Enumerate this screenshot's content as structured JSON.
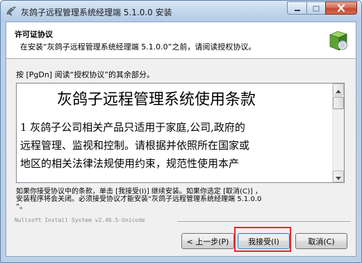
{
  "window": {
    "title": "灰鸽子远程管理系统经理端 5.1.0.0 安装"
  },
  "header": {
    "title": "许可证协议",
    "subtitle": "在安装“灰鸽子远程管理系统经理端 5.1.0.0”之前，请阅读授权协议。"
  },
  "instruction": "按 [PgDn] 阅读“授权协议”的其余部分。",
  "license": {
    "heading": "灰鸽子远程管理系统使用条款",
    "lines": [
      "1  灰鸽子公司相关产品只适用于家庭,公司,政府的",
      "远程管理、监视和控制。请根据并依照所在国家或",
      "地区的相关法律法规使用约束，规范性使用本产"
    ]
  },
  "notice": {
    "lines": [
      "如果你接受协议中的条款，单击 [我接受(I)] 继续安装。如果你选定 [取消(C)] ，",
      "安装程序将会关闭。必须接受协议才能安装“灰鸽子远程管理系统经理端 5.1.0.0",
      "”。"
    ]
  },
  "branding": "Nullsoft Install System v2.46.5-Unicode",
  "buttons": {
    "back": "< 上一步(P)",
    "accept": "我接受(I)",
    "cancel": "取消(C)"
  },
  "colors": {
    "highlight": "#e8252b",
    "title_bar": "#c3d6ec",
    "close_button": "#c24a32"
  }
}
